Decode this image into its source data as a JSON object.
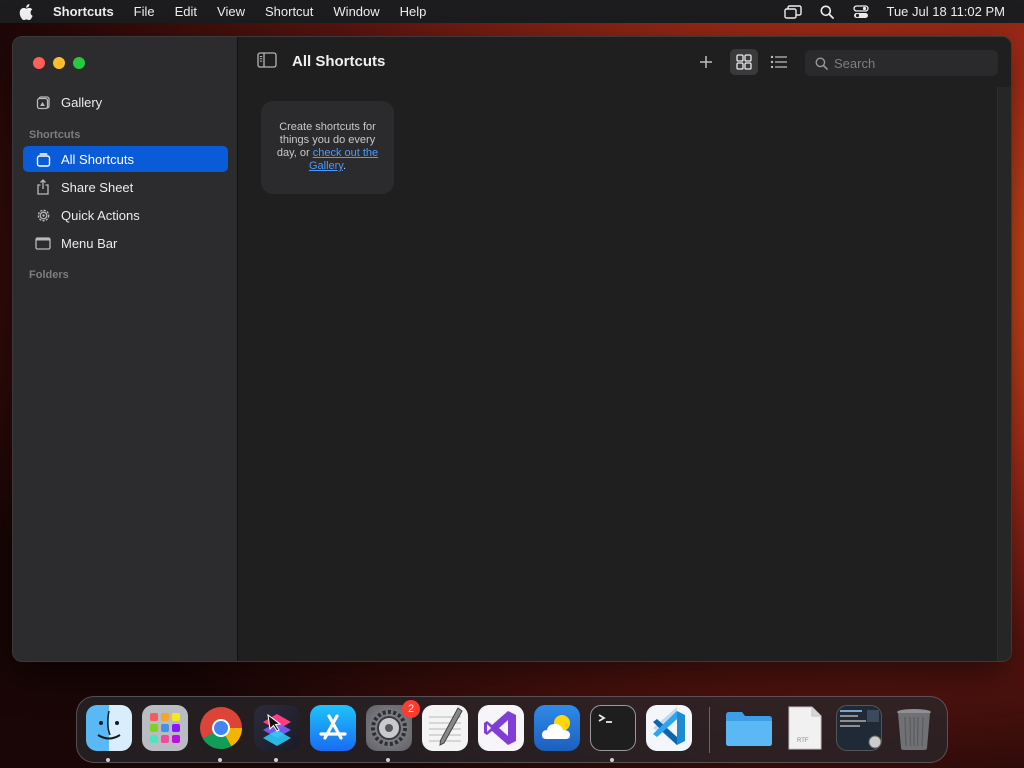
{
  "menubar": {
    "app_name": "Shortcuts",
    "items": [
      "File",
      "Edit",
      "View",
      "Shortcut",
      "Window",
      "Help"
    ],
    "clock": "Tue Jul 18  11:02 PM"
  },
  "sidebar": {
    "gallery": "Gallery",
    "shortcuts_section": "Shortcuts",
    "items": [
      {
        "label": "All Shortcuts",
        "icon": "all-shortcuts-icon",
        "active": true
      },
      {
        "label": "Share Sheet",
        "icon": "share-icon"
      },
      {
        "label": "Quick Actions",
        "icon": "gear-icon"
      },
      {
        "label": "Menu Bar",
        "icon": "menu-bar-icon"
      }
    ],
    "folders_section": "Folders"
  },
  "toolbar": {
    "title": "All Shortcuts",
    "search_placeholder": "Search"
  },
  "empty_state": {
    "text": "Create shortcuts for things you do every day, or ",
    "link": "check out the Gallery",
    "suffix": "."
  },
  "dock": {
    "apps": [
      "Finder",
      "Launchpad",
      "Google Chrome",
      "Shortcuts",
      "App Store",
      "System Settings",
      "TextEdit",
      "Visual Studio",
      "Weather",
      "Terminal",
      "Visual Studio Code",
      "Downloads",
      "RTF Document",
      "Screenshot",
      "Trash"
    ],
    "settings_badge": "2",
    "rtf_label": "RTF"
  },
  "colors": {
    "accent": "#0a5bd7",
    "link": "#4a9cff",
    "close": "#ff5f57",
    "minimize": "#febc2e",
    "maximize": "#28c840"
  }
}
